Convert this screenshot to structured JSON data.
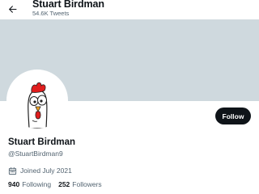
{
  "header": {
    "name": "Stuart Birdman",
    "tweet_count": "54.6K Tweets",
    "back_icon": "back-arrow-icon"
  },
  "colors": {
    "banner": "#cfd9de",
    "text_primary": "#0f1419",
    "text_secondary": "#536471",
    "follow_button_bg": "#0f1419",
    "follow_button_text": "#ffffff"
  },
  "profile": {
    "display_name": "Stuart Birdman",
    "handle": "@StuartBirdman9",
    "joined": "Joined July 2021",
    "joined_icon": "calendar-icon",
    "avatar_icon": "cartoon-chicken-avatar"
  },
  "actions": {
    "follow_label": "Follow"
  },
  "stats": {
    "following_count": "940",
    "following_label": "Following",
    "followers_count": "252",
    "followers_label": "Followers"
  }
}
